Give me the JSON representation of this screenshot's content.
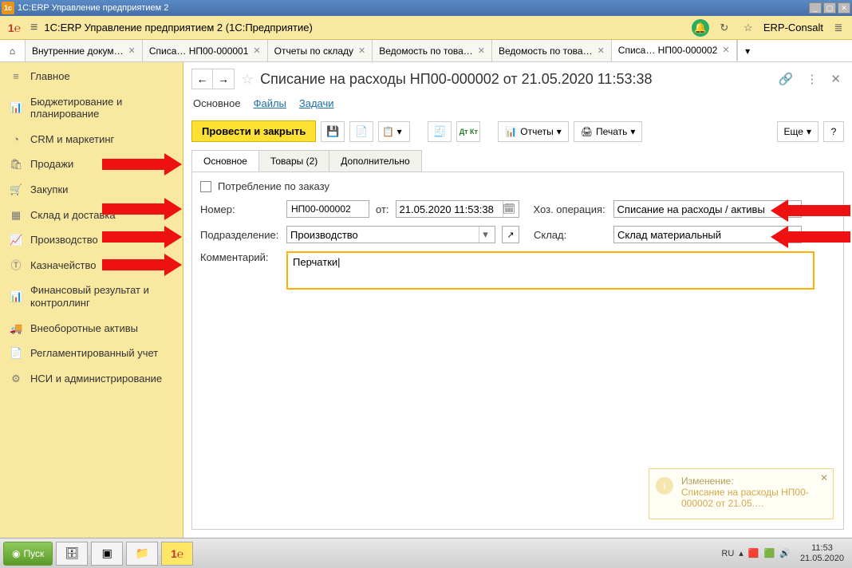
{
  "titlebar": {
    "text": "1C:ERP Управление предприятием 2"
  },
  "toptool": {
    "title": "1C:ERP Управление предприятием 2  (1С:Предприятие)",
    "consult": "ERP-Consalt"
  },
  "tabs": [
    {
      "label": "Внутренние докум…",
      "active": false
    },
    {
      "label": "Списа… НП00-000001",
      "active": false
    },
    {
      "label": "Отчеты по складу",
      "active": false
    },
    {
      "label": "Ведомость по това…",
      "active": false
    },
    {
      "label": "Ведомость по това…",
      "active": false
    },
    {
      "label": "Списа… НП00-000002",
      "active": true
    }
  ],
  "sidebar": [
    {
      "icon": "≡",
      "label": "Главное"
    },
    {
      "icon": "📊",
      "label": "Бюджетирование и планирование"
    },
    {
      "icon": "◔",
      "label": "CRM и маркетинг"
    },
    {
      "icon": "🛍",
      "label": "Продажи"
    },
    {
      "icon": "🛒",
      "label": "Закупки"
    },
    {
      "icon": "▦",
      "label": "Склад и доставка"
    },
    {
      "icon": "📈",
      "label": "Производство"
    },
    {
      "icon": "Ⓣ",
      "label": "Казначейство"
    },
    {
      "icon": "📊",
      "label": "Финансовый результат и контроллинг"
    },
    {
      "icon": "🚚",
      "label": "Внеоборотные активы"
    },
    {
      "icon": "📄",
      "label": "Регламентированный учет"
    },
    {
      "icon": "⚙",
      "label": "НСИ и администрирование"
    }
  ],
  "doc": {
    "title": "Списание на расходы НП00-000002 от 21.05.2020 11:53:38",
    "links": {
      "main": "Основное",
      "files": "Файлы",
      "tasks": "Задачи"
    },
    "btn_post_close": "Провести и закрыть",
    "btn_reports": "Отчеты",
    "btn_print": "Печать",
    "btn_more": "Еще",
    "tabs2": {
      "main": "Основное",
      "goods": "Товары (2)",
      "extra": "Дополнительно"
    },
    "check_label": "Потребление по заказу",
    "lbl_number": "Номер:",
    "number": "НП00-000002",
    "lbl_from": "от:",
    "date": "21.05.2020 11:53:38",
    "lbl_op": "Хоз. операция:",
    "op": "Списание на расходы / активы",
    "lbl_dept": "Подразделение:",
    "dept": "Производство",
    "lbl_wh": "Склад:",
    "wh": "Склад материальный",
    "lbl_comment": "Комментарий:",
    "comment": "Перчатки"
  },
  "notif": {
    "title": "Изменение:",
    "link": "Списание на расходы НП00-000002 от 21.05.…"
  },
  "taskbar": {
    "start": "Пуск",
    "lang": "RU",
    "time": "11:53",
    "date": "21.05.2020"
  }
}
